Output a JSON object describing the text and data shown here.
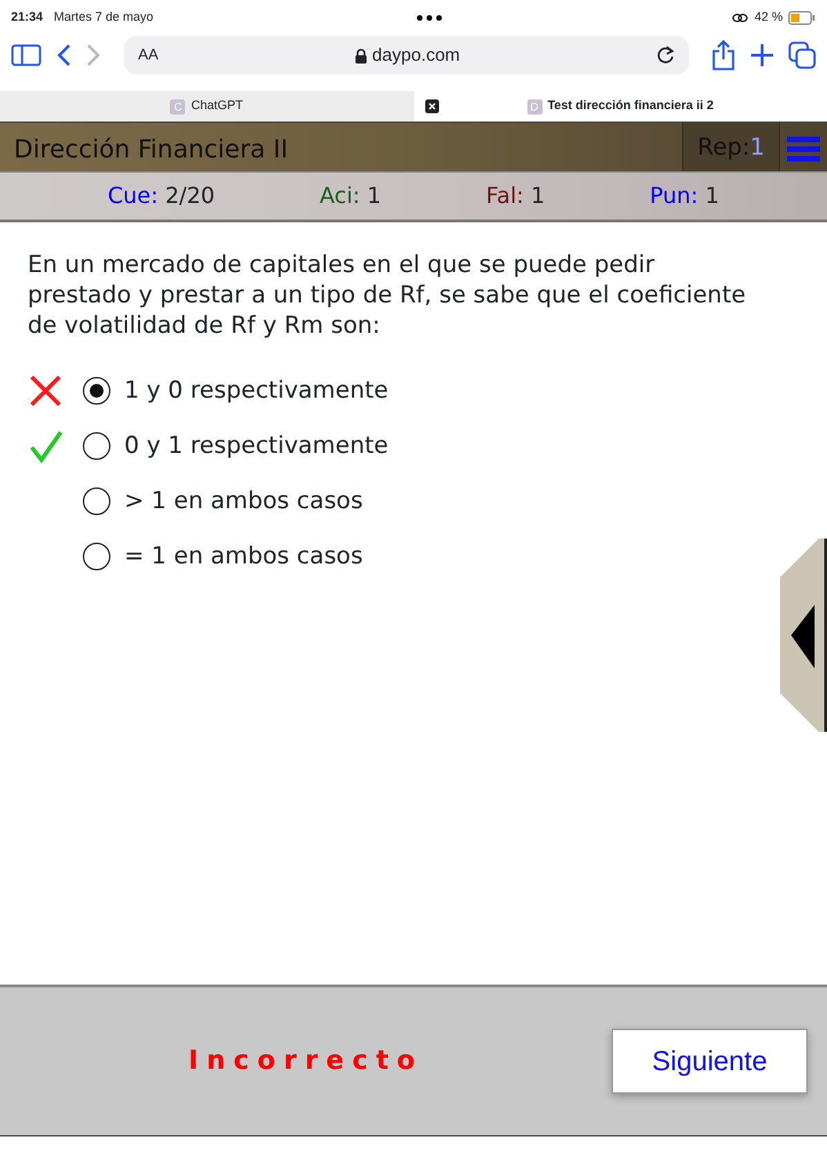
{
  "status_bar": {
    "time": "21:34",
    "date": "Martes 7 de mayo",
    "battery": "42 %"
  },
  "browser": {
    "text_size": "AA",
    "url": "daypo.com"
  },
  "tabs": [
    {
      "favicon": "C",
      "label": "ChatGPT",
      "selected": false
    },
    {
      "favicon": "D",
      "label": "Test dirección financiera ii 2",
      "selected": true
    }
  ],
  "header": {
    "title": "Dirección Financiera II",
    "rep_label": "Rep:",
    "rep_value": "1"
  },
  "stats": [
    {
      "label": "Cue:",
      "value": "2/20",
      "color": "#0000ff"
    },
    {
      "label": "Aci:",
      "value": "1",
      "color": "#1a5c1a"
    },
    {
      "label": "Fal:",
      "value": "1",
      "color": "#6b1414"
    },
    {
      "label": "Pun:",
      "value": "1",
      "color": "#0000ff"
    }
  ],
  "question": "En un mercado de capitales en el que se puede pedir prestado y prestar a un tipo de Rf, se sabe que el coeficiente de volatilidad de Rf y Rm son:",
  "options": [
    {
      "text": "1 y 0 respectivamente",
      "selected": true,
      "kind": "wrong"
    },
    {
      "text": "0 y 1 respectivamente",
      "selected": false,
      "kind": "right"
    },
    {
      "text": "> 1 en ambos casos",
      "selected": false,
      "kind": "plain"
    },
    {
      "text": "= 1 en ambos casos",
      "selected": false,
      "kind": "plain"
    }
  ],
  "result": "Incorrecto",
  "next_button": "Siguiente"
}
